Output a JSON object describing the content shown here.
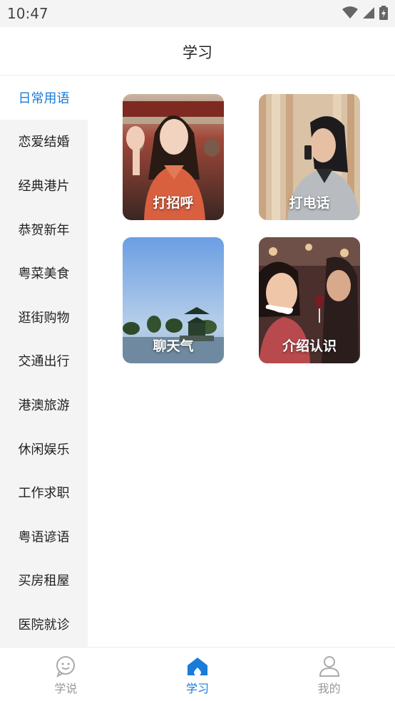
{
  "status_bar": {
    "time": "10:47"
  },
  "header": {
    "title": "学习"
  },
  "sidebar": {
    "items": [
      {
        "label": "日常用语",
        "active": true
      },
      {
        "label": "恋爱结婚"
      },
      {
        "label": "经典港片"
      },
      {
        "label": "恭贺新年"
      },
      {
        "label": "粤菜美食"
      },
      {
        "label": "逛街购物"
      },
      {
        "label": "交通出行"
      },
      {
        "label": "港澳旅游"
      },
      {
        "label": "休闲娱乐"
      },
      {
        "label": "工作求职"
      },
      {
        "label": "粤语谚语"
      },
      {
        "label": "买房租屋"
      },
      {
        "label": "医院就诊"
      }
    ]
  },
  "cards": [
    {
      "label": "打招呼"
    },
    {
      "label": "打电话"
    },
    {
      "label": "聊天气"
    },
    {
      "label": "介绍认识"
    }
  ],
  "tab_bar": {
    "tabs": [
      {
        "label": "学说",
        "icon": "smile-chat-icon"
      },
      {
        "label": "学习",
        "icon": "home-icon",
        "active": true
      },
      {
        "label": "我的",
        "icon": "user-icon"
      }
    ]
  },
  "colors": {
    "accent": "#1a7bd9",
    "sidebar_bg": "#f4f4f4",
    "inactive": "#999999"
  }
}
